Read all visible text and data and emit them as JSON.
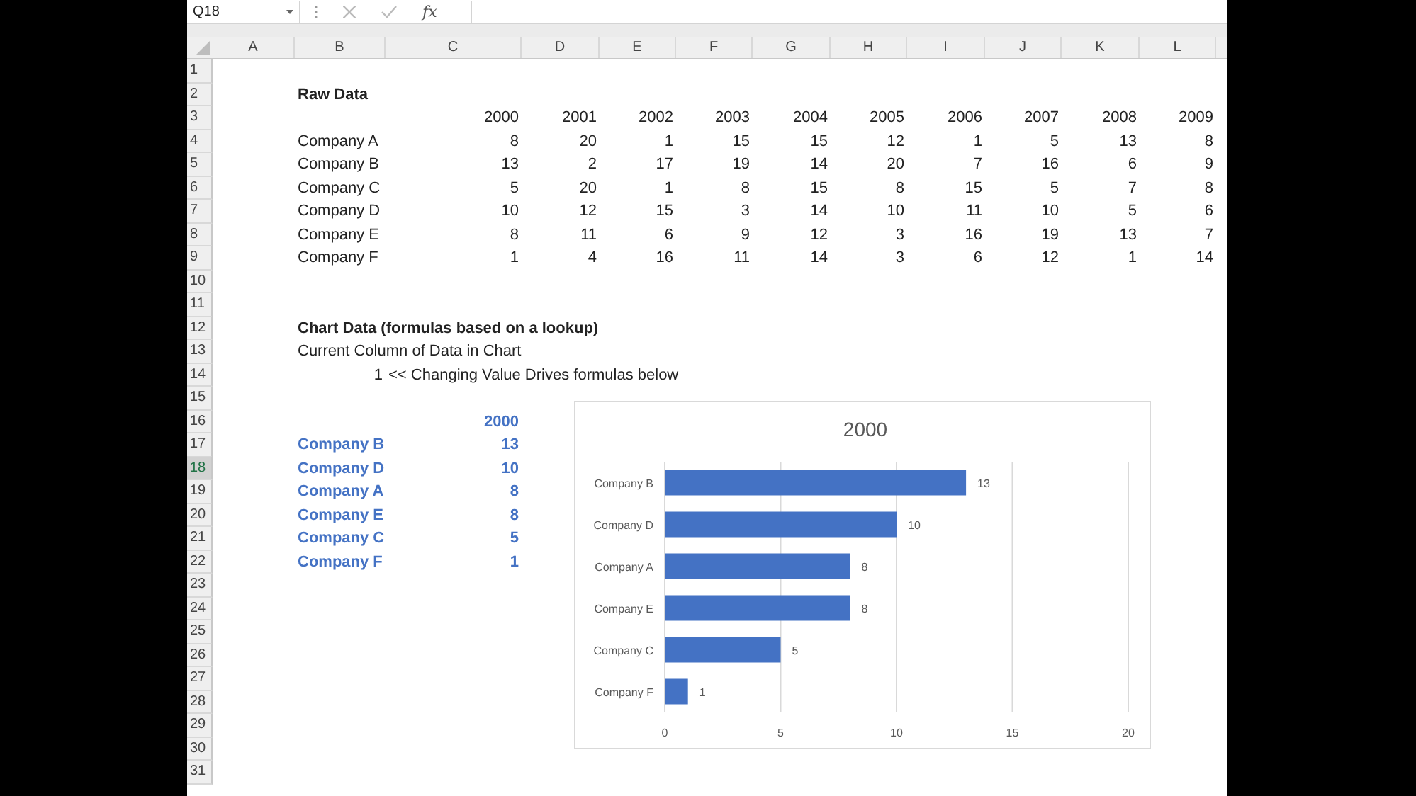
{
  "formula_bar": {
    "name_box": "Q18",
    "function_label": "fx"
  },
  "sheet": {
    "columns": [
      "A",
      "B",
      "C",
      "D",
      "E",
      "F",
      "G",
      "H",
      "I",
      "J",
      "K",
      "L"
    ],
    "rows": [
      {
        "number": "1",
        "selected": false,
        "cells": {}
      },
      {
        "number": "2",
        "selected": false,
        "cells": {
          "B": {
            "text": "Raw Data",
            "kind": "text",
            "bold": true
          }
        }
      },
      {
        "number": "3",
        "selected": false,
        "cells": {
          "C": {
            "text": "2000",
            "kind": "number"
          },
          "D": {
            "text": "2001",
            "kind": "number"
          },
          "E": {
            "text": "2002",
            "kind": "number"
          },
          "F": {
            "text": "2003",
            "kind": "number"
          },
          "G": {
            "text": "2004",
            "kind": "number"
          },
          "H": {
            "text": "2005",
            "kind": "number"
          },
          "I": {
            "text": "2006",
            "kind": "number"
          },
          "J": {
            "text": "2007",
            "kind": "number"
          },
          "K": {
            "text": "2008",
            "kind": "number"
          },
          "L": {
            "text": "2009",
            "kind": "number"
          }
        }
      },
      {
        "number": "4",
        "selected": false,
        "cells": {
          "B": {
            "text": "Company A",
            "kind": "text"
          },
          "C": {
            "text": "8",
            "kind": "number"
          },
          "D": {
            "text": "20",
            "kind": "number"
          },
          "E": {
            "text": "1",
            "kind": "number"
          },
          "F": {
            "text": "15",
            "kind": "number"
          },
          "G": {
            "text": "15",
            "kind": "number"
          },
          "H": {
            "text": "12",
            "kind": "number"
          },
          "I": {
            "text": "1",
            "kind": "number"
          },
          "J": {
            "text": "5",
            "kind": "number"
          },
          "K": {
            "text": "13",
            "kind": "number"
          },
          "L": {
            "text": "8",
            "kind": "number"
          }
        }
      },
      {
        "number": "5",
        "selected": false,
        "cells": {
          "B": {
            "text": "Company B",
            "kind": "text"
          },
          "C": {
            "text": "13",
            "kind": "number"
          },
          "D": {
            "text": "2",
            "kind": "number"
          },
          "E": {
            "text": "17",
            "kind": "number"
          },
          "F": {
            "text": "19",
            "kind": "number"
          },
          "G": {
            "text": "14",
            "kind": "number"
          },
          "H": {
            "text": "20",
            "kind": "number"
          },
          "I": {
            "text": "7",
            "kind": "number"
          },
          "J": {
            "text": "16",
            "kind": "number"
          },
          "K": {
            "text": "6",
            "kind": "number"
          },
          "L": {
            "text": "9",
            "kind": "number"
          }
        }
      },
      {
        "number": "6",
        "selected": false,
        "cells": {
          "B": {
            "text": "Company C",
            "kind": "text"
          },
          "C": {
            "text": "5",
            "kind": "number"
          },
          "D": {
            "text": "20",
            "kind": "number"
          },
          "E": {
            "text": "1",
            "kind": "number"
          },
          "F": {
            "text": "8",
            "kind": "number"
          },
          "G": {
            "text": "15",
            "kind": "number"
          },
          "H": {
            "text": "8",
            "kind": "number"
          },
          "I": {
            "text": "15",
            "kind": "number"
          },
          "J": {
            "text": "5",
            "kind": "number"
          },
          "K": {
            "text": "7",
            "kind": "number"
          },
          "L": {
            "text": "8",
            "kind": "number"
          }
        }
      },
      {
        "number": "7",
        "selected": false,
        "cells": {
          "B": {
            "text": "Company D",
            "kind": "text"
          },
          "C": {
            "text": "10",
            "kind": "number"
          },
          "D": {
            "text": "12",
            "kind": "number"
          },
          "E": {
            "text": "15",
            "kind": "number"
          },
          "F": {
            "text": "3",
            "kind": "number"
          },
          "G": {
            "text": "14",
            "kind": "number"
          },
          "H": {
            "text": "10",
            "kind": "number"
          },
          "I": {
            "text": "11",
            "kind": "number"
          },
          "J": {
            "text": "10",
            "kind": "number"
          },
          "K": {
            "text": "5",
            "kind": "number"
          },
          "L": {
            "text": "6",
            "kind": "number"
          }
        }
      },
      {
        "number": "8",
        "selected": false,
        "cells": {
          "B": {
            "text": "Company E",
            "kind": "text"
          },
          "C": {
            "text": "8",
            "kind": "number"
          },
          "D": {
            "text": "11",
            "kind": "number"
          },
          "E": {
            "text": "6",
            "kind": "number"
          },
          "F": {
            "text": "9",
            "kind": "number"
          },
          "G": {
            "text": "12",
            "kind": "number"
          },
          "H": {
            "text": "3",
            "kind": "number"
          },
          "I": {
            "text": "16",
            "kind": "number"
          },
          "J": {
            "text": "19",
            "kind": "number"
          },
          "K": {
            "text": "13",
            "kind": "number"
          },
          "L": {
            "text": "7",
            "kind": "number"
          }
        }
      },
      {
        "number": "9",
        "selected": false,
        "cells": {
          "B": {
            "text": "Company F",
            "kind": "text"
          },
          "C": {
            "text": "1",
            "kind": "number"
          },
          "D": {
            "text": "4",
            "kind": "number"
          },
          "E": {
            "text": "16",
            "kind": "number"
          },
          "F": {
            "text": "11",
            "kind": "number"
          },
          "G": {
            "text": "14",
            "kind": "number"
          },
          "H": {
            "text": "3",
            "kind": "number"
          },
          "I": {
            "text": "6",
            "kind": "number"
          },
          "J": {
            "text": "12",
            "kind": "number"
          },
          "K": {
            "text": "1",
            "kind": "number"
          },
          "L": {
            "text": "14",
            "kind": "number"
          }
        }
      },
      {
        "number": "10",
        "selected": false,
        "cells": {}
      },
      {
        "number": "11",
        "selected": false,
        "cells": {}
      },
      {
        "number": "12",
        "selected": false,
        "cells": {
          "B": {
            "text": "Chart Data (formulas based on a lookup)",
            "kind": "text",
            "bold": true
          }
        }
      },
      {
        "number": "13",
        "selected": false,
        "cells": {
          "B": {
            "text": "Current Column of Data in Chart",
            "kind": "text"
          }
        }
      },
      {
        "number": "14",
        "selected": false,
        "cells": {
          "B": {
            "text": "1",
            "kind": "number"
          },
          "C": {
            "text": "<< Changing Value Drives formulas below",
            "kind": "text"
          }
        }
      },
      {
        "number": "15",
        "selected": false,
        "cells": {}
      },
      {
        "number": "16",
        "selected": false,
        "cells": {
          "C": {
            "text": "2000",
            "kind": "number",
            "bold": true,
            "color": "#4472c4"
          }
        }
      },
      {
        "number": "17",
        "selected": false,
        "cells": {
          "B": {
            "text": "Company B",
            "kind": "text",
            "bold": true,
            "color": "#4472c4"
          },
          "C": {
            "text": "13",
            "kind": "number",
            "bold": true,
            "color": "#4472c4"
          }
        }
      },
      {
        "number": "18",
        "selected": true,
        "cells": {
          "B": {
            "text": "Company D",
            "kind": "text",
            "bold": true,
            "color": "#4472c4"
          },
          "C": {
            "text": "10",
            "kind": "number",
            "bold": true,
            "color": "#4472c4"
          }
        }
      },
      {
        "number": "19",
        "selected": false,
        "cells": {
          "B": {
            "text": "Company A",
            "kind": "text",
            "bold": true,
            "color": "#4472c4"
          },
          "C": {
            "text": "8",
            "kind": "number",
            "bold": true,
            "color": "#4472c4"
          }
        }
      },
      {
        "number": "20",
        "selected": false,
        "cells": {
          "B": {
            "text": "Company E",
            "kind": "text",
            "bold": true,
            "color": "#4472c4"
          },
          "C": {
            "text": "8",
            "kind": "number",
            "bold": true,
            "color": "#4472c4"
          }
        }
      },
      {
        "number": "21",
        "selected": false,
        "cells": {
          "B": {
            "text": "Company C",
            "kind": "text",
            "bold": true,
            "color": "#4472c4"
          },
          "C": {
            "text": "5",
            "kind": "number",
            "bold": true,
            "color": "#4472c4"
          }
        }
      },
      {
        "number": "22",
        "selected": false,
        "cells": {
          "B": {
            "text": "Company F",
            "kind": "text",
            "bold": true,
            "color": "#4472c4"
          },
          "C": {
            "text": "1",
            "kind": "number",
            "bold": true,
            "color": "#4472c4"
          }
        }
      },
      {
        "number": "23",
        "selected": false,
        "cells": {}
      },
      {
        "number": "24",
        "selected": false,
        "cells": {}
      },
      {
        "number": "25",
        "selected": false,
        "cells": {}
      },
      {
        "number": "26",
        "selected": false,
        "cells": {}
      },
      {
        "number": "27",
        "selected": false,
        "cells": {}
      },
      {
        "number": "28",
        "selected": false,
        "cells": {}
      },
      {
        "number": "29",
        "selected": false,
        "cells": {}
      },
      {
        "number": "30",
        "selected": false,
        "cells": {}
      },
      {
        "number": "31",
        "selected": false,
        "cells": {}
      }
    ]
  },
  "chart": {
    "chart_data": {
      "type": "bar",
      "orientation": "horizontal",
      "title": "2000",
      "categories": [
        "Company B",
        "Company D",
        "Company A",
        "Company E",
        "Company C",
        "Company F"
      ],
      "series": [
        {
          "color": "#4472c4",
          "values": [
            13,
            10,
            8,
            8,
            5,
            1
          ]
        }
      ],
      "xlim": [
        0,
        20
      ],
      "xticks": [
        0,
        5,
        10,
        15,
        20
      ],
      "grid": true,
      "data_labels": true
    }
  }
}
